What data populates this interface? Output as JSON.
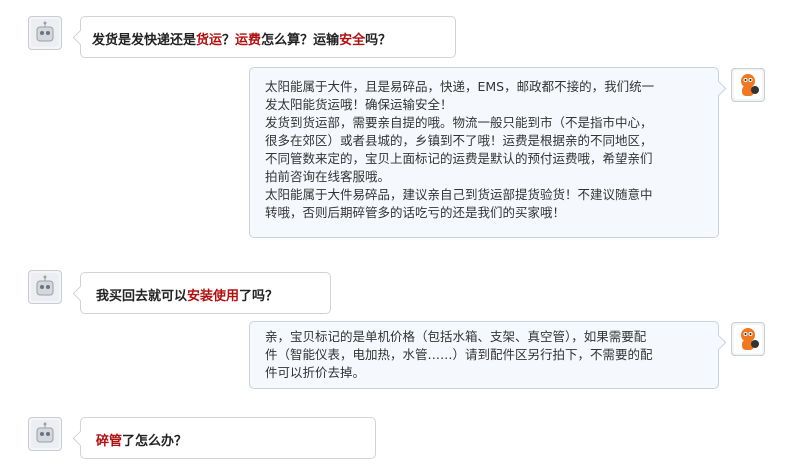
{
  "colors": {
    "highlight": "#b01010"
  },
  "icons": {
    "customer_avatar": "robot-face-icon",
    "seller_avatar": "orange-mascot-icon"
  },
  "conversation": [
    {
      "question": {
        "parts": [
          "发货是发快递还是",
          "货运",
          "？",
          "运费",
          "怎么算？运输",
          "安全",
          "吗？"
        ]
      },
      "answer": {
        "lines": [
          "太阳能属于大件，且是易碎品，快递，EMS，邮政都不接的，我们统一",
          "发太阳能货运哦！确保运输安全！",
          "发货到货运部，需要亲自提的哦。物流一般只能到市（不是指市中心，",
          "很多在郊区）或者县城的，乡镇到不了哦！运费是根据亲的不同地区，",
          "不同管数来定的，宝贝上面标记的运费是默认的预付运费哦，希望亲们",
          "拍前咨询在线客服哦。",
          "太阳能属于大件易碎品，建议亲自己到货运部提货验货！不建议随意中",
          "转哦，否则后期碎管多的话吃亏的还是我们的买家哦！"
        ]
      }
    },
    {
      "question": {
        "parts": [
          "我买回去就可以",
          "安装使用",
          "了吗？"
        ]
      },
      "answer": {
        "lines": [
          "亲，宝贝标记的是单机价格（包括水箱、支架、真空管），如果需要配",
          "件（智能仪表，电加热，水管……）请到配件区另行拍下，不需要的配",
          "件可以折价去掉。"
        ]
      }
    },
    {
      "question": {
        "parts": [
          "碎管",
          "了怎么办？"
        ]
      }
    }
  ]
}
